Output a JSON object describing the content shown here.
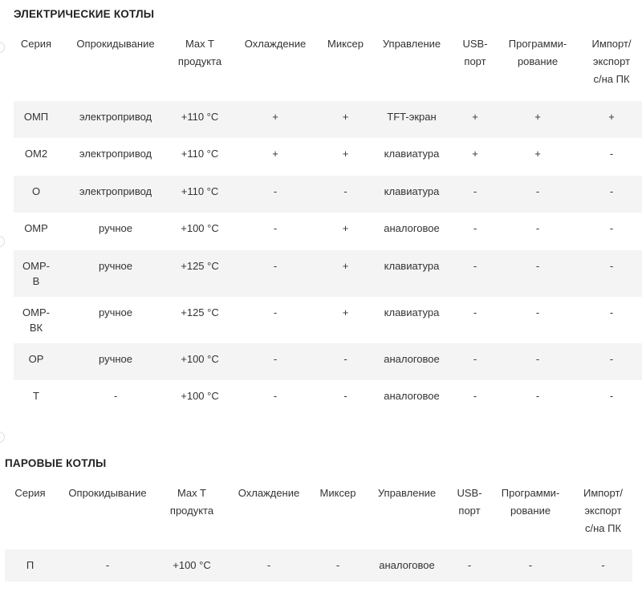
{
  "electric": {
    "title": "ЭЛЕКТРИЧЕСКИЕ КОТЛЫ",
    "headers": [
      "Серия",
      "Опрокидывание",
      "Max T\nпродукта",
      "Охлаждение",
      "Миксер",
      "Управление",
      "USB-\nпорт",
      "Программи-\nрование",
      "Импорт/\nэкспорт\nс/на  ПК"
    ],
    "rows": [
      [
        "ОМП",
        "электропривод",
        "+110 °С",
        "+",
        "+",
        "TFT-экран",
        "+",
        "+",
        "+"
      ],
      [
        "ОМ2",
        "электропривод",
        "+110 °С",
        "+",
        "+",
        "клавиатура",
        "+",
        "+",
        "-"
      ],
      [
        "О",
        "электропривод",
        "+110 °С",
        "-",
        "-",
        "клавиатура",
        "-",
        "-",
        "-"
      ],
      [
        "ОМР",
        "ручное",
        "+100 °С",
        "-",
        "+",
        "аналоговое",
        "-",
        "-",
        "-"
      ],
      [
        "ОМР-\nВ",
        "ручное",
        "+125 °С",
        "-",
        "+",
        "клавиатура",
        "-",
        "-",
        "-"
      ],
      [
        "ОМР-\nВК",
        "ручное",
        "+125 °С",
        "-",
        "+",
        "клавиатура",
        "-",
        "-",
        "-"
      ],
      [
        "ОР",
        "ручное",
        "+100 °С",
        "-",
        "-",
        "аналоговое",
        "-",
        "-",
        "-"
      ],
      [
        "Т",
        "-",
        "+100 °С",
        "-",
        "-",
        "аналоговое",
        "-",
        "-",
        "-"
      ]
    ]
  },
  "steam": {
    "title": "ПАРОВЫЕ КОТЛЫ",
    "headers": [
      "Серия",
      "Опрокидывание",
      "Max T\nпродукта",
      "Охлаждение",
      "Миксер",
      "Управление",
      "USB-\nпорт",
      "Программи-\nрование",
      "Импорт/\nэкспорт\nс/на ПК"
    ],
    "rows": [
      [
        "П",
        "-",
        "+100 °С",
        "-",
        "-",
        "аналоговое",
        "-",
        "-",
        "-"
      ]
    ]
  }
}
